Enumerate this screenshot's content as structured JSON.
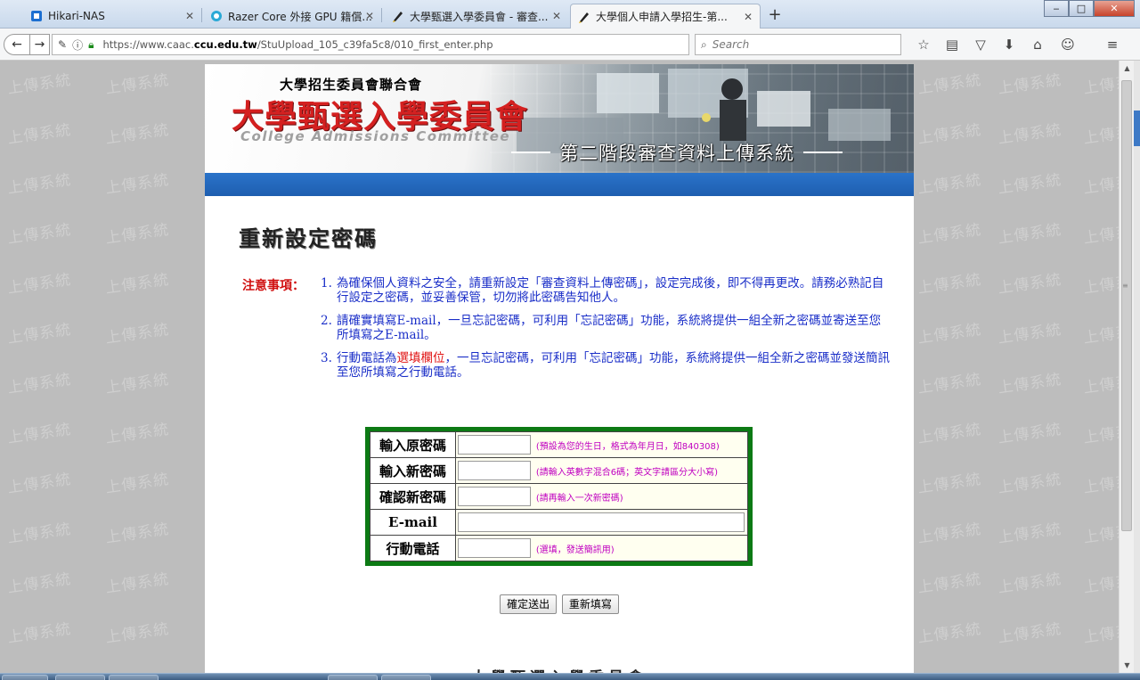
{
  "browser": {
    "tabs": [
      {
        "title": "Hikari-NAS",
        "icon": "nas-icon",
        "active": false
      },
      {
        "title": "Razer Core 外接 GPU 籍償...",
        "icon": "razer-icon",
        "active": false
      },
      {
        "title": "大學甄選入學委員會 - 審查...",
        "icon": "pen-icon",
        "active": false
      },
      {
        "title": "大學個人申請入學招生-第...",
        "icon": "pen-icon",
        "active": true
      }
    ],
    "url_prefix": "https://www.caac.",
    "url_domain": "ccu.edu.tw",
    "url_path": "/StuUpload_105_c39fa5c8/010_first_enter.php",
    "search_placeholder": "Search"
  },
  "watermark": "上傳系統",
  "banner": {
    "org": "大學招生委員會聯合會",
    "main": "大學甄選入學委員會",
    "english": "College Admissions Committee",
    "system": "第二階段審查資料上傳系統"
  },
  "page_title": "重新設定密碼",
  "notice": {
    "label": "注意事項：",
    "items": [
      {
        "num": "1.",
        "text": "為確保個人資料之安全，請重新設定「審查資料上傳密碼」，設定完成後，即不得再更改。請務必熟記自行設定之密碼，並妥善保管，切勿將此密碼告知他人。"
      },
      {
        "num": "2.",
        "text": "請確實填寫E-mail，一旦忘記密碼，可利用「忘記密碼」功能，系統將提供一組全新之密碼並寄送至您所填寫之E-mail。"
      },
      {
        "num": "3.",
        "text_before": "行動電話為",
        "text_red": "選填欄位",
        "text_after": "，一旦忘記密碼，可利用「忘記密碼」功能，系統將提供一組全新之密碼並發送簡訊至您所填寫之行動電話。"
      }
    ]
  },
  "form": {
    "rows": [
      {
        "label": "輸入原密碼",
        "value": "",
        "hint": "(預設為您的生日，格式為年月日，如840308)"
      },
      {
        "label": "輸入新密碼",
        "value": "",
        "hint": "(請輸入英數字混合6碼；英文字請區分大小寫)"
      },
      {
        "label": "確認新密碼",
        "value": "",
        "hint": "(請再輸入一次新密碼)"
      },
      {
        "label": "E-mail",
        "value": "",
        "hint": ""
      },
      {
        "label": "行動電話",
        "value": "",
        "hint": "(選填，發送簡訊用)"
      }
    ],
    "submit_label": "確定送出",
    "reset_label": "重新填寫"
  },
  "footer_title": "大學甄選入學委員會"
}
